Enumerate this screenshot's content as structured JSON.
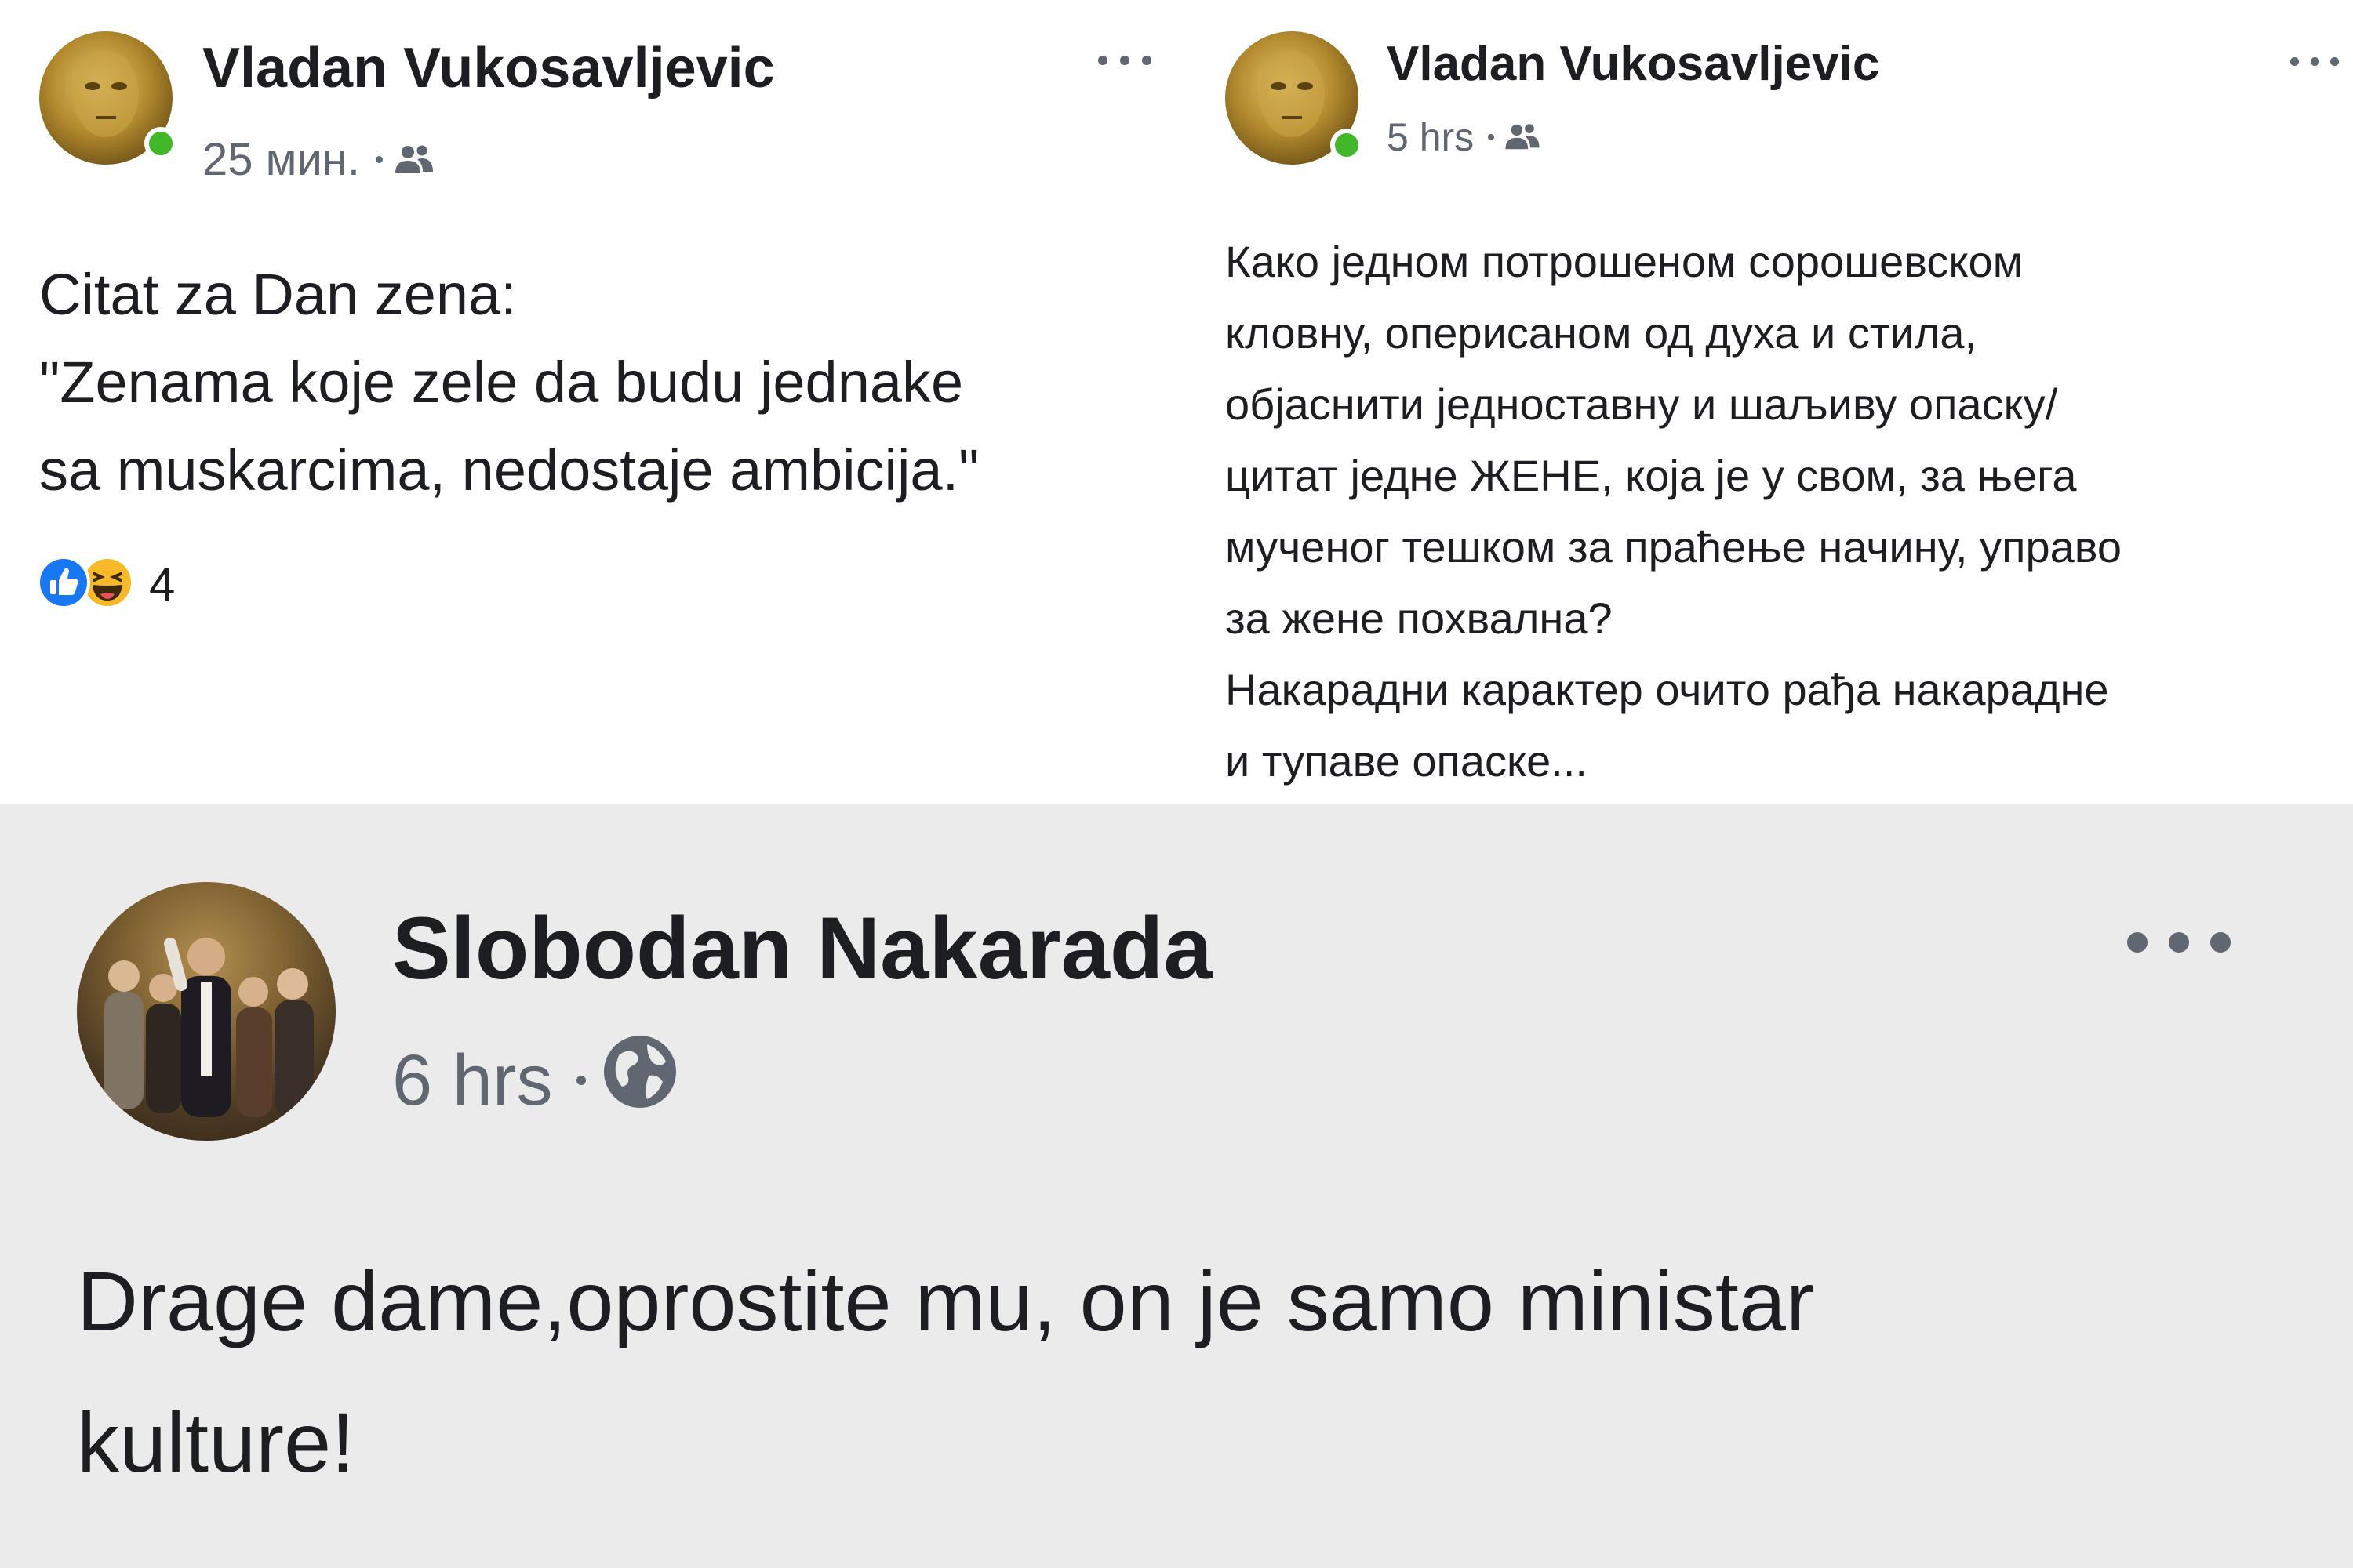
{
  "posts": [
    {
      "author": "Vladan Vukosavljevic",
      "time": "25 мин.",
      "audience_icon": "friends-icon",
      "text": "Citat za Dan zena:\n\"Zenama koje zele da budu jednake\nsa muskarcima, nedostaje ambicija.\"",
      "reaction_icons": [
        "like-icon",
        "haha-icon"
      ],
      "reaction_count": "4",
      "online": true
    },
    {
      "author": "Vladan Vukosavljevic",
      "time": "5 hrs",
      "audience_icon": "friends-icon",
      "text": "Како једном потрошеном сорошевском\nкловну, оперисаном од духа и стила,\nобјаснити једноставну и шаљиву опаску/\nцитат једне ЖЕНЕ, која је у свом, за њега\nмученог тешком за праћење начину, управо\nза жене похвална?\nНакарадни карактер очито рађа накарадне\nи тупаве опаске...",
      "online": true
    },
    {
      "author": "Slobodan Nakarada",
      "time": "6 hrs",
      "audience_icon": "globe-icon",
      "text": "Drage dame,oprostite mu, on je samo ministar\nkulture!",
      "online": false
    }
  ],
  "colors": {
    "text": "#1c1e21",
    "meta": "#606770",
    "online": "#42b72a",
    "like": "#1877f2",
    "haha": "#f7b928",
    "bottom_background": "#ebebec"
  }
}
